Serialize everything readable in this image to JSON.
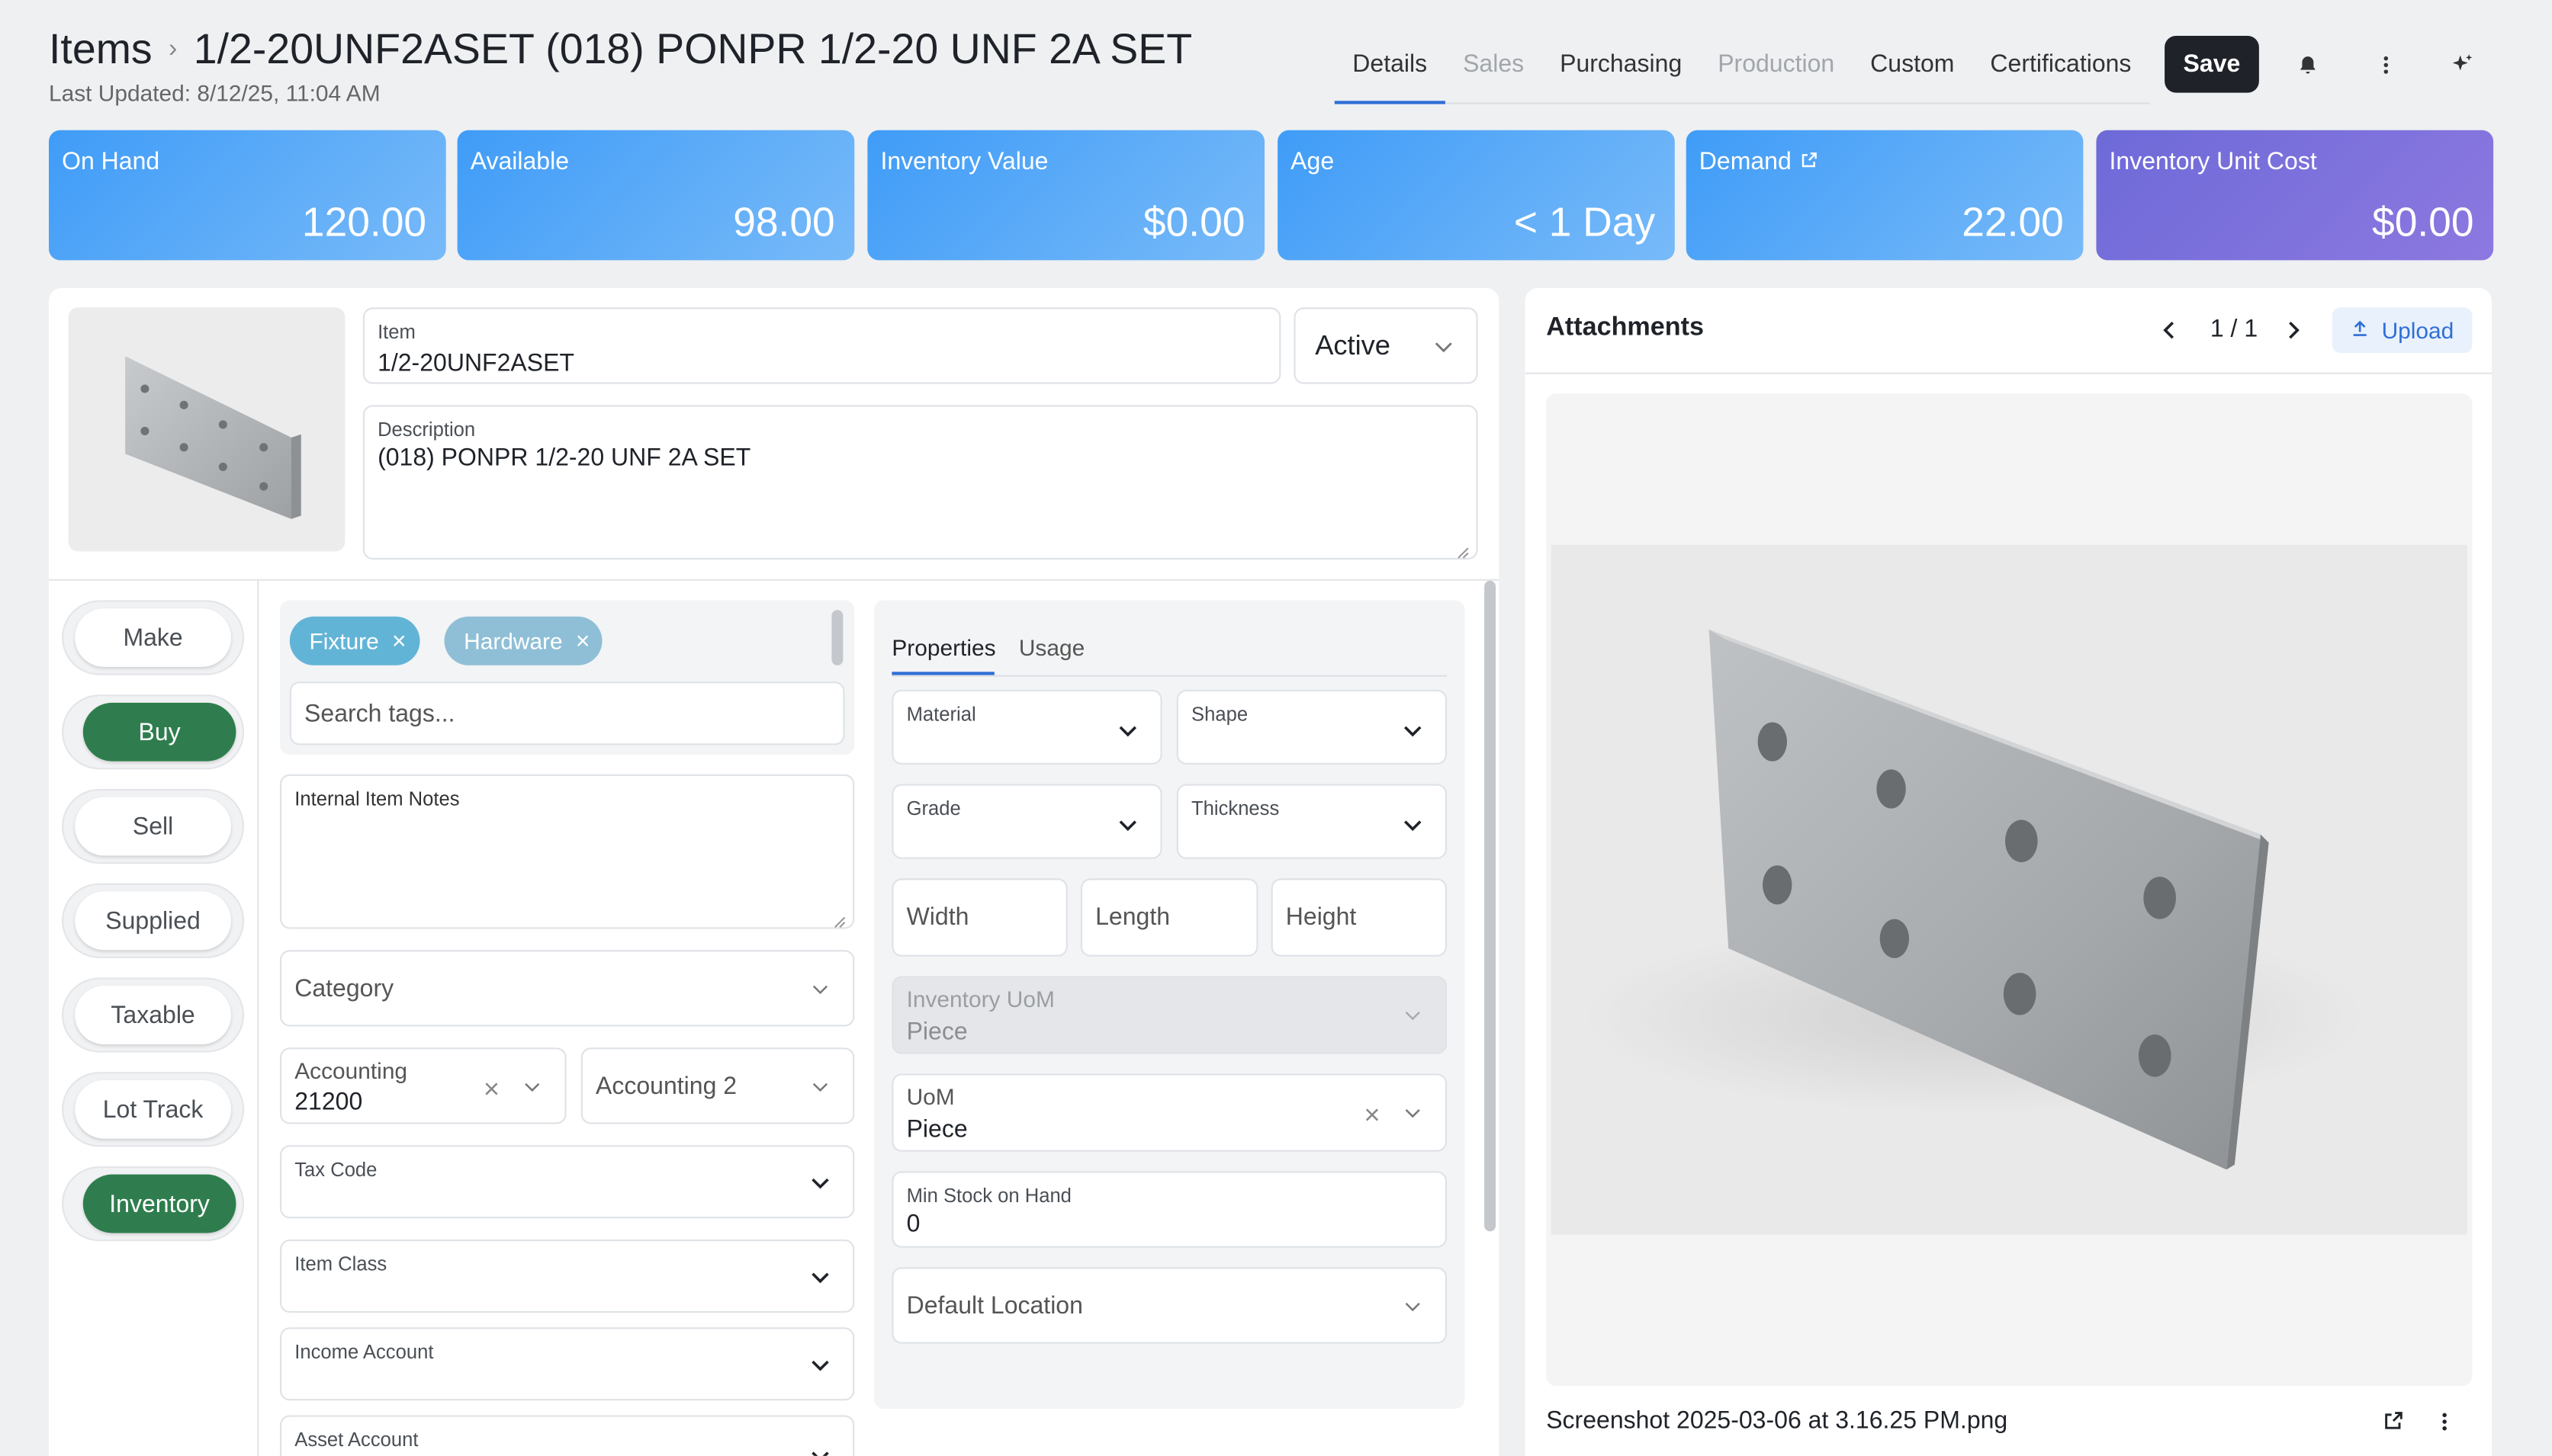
{
  "header": {
    "breadcrumb_root": "Items",
    "title": "1/2-20UNF2ASET (018) PONPR 1/2-20 UNF 2A SET",
    "last_updated": "Last Updated: 8/12/25, 11:04 AM",
    "tabs": [
      {
        "label": "Details",
        "state": "active"
      },
      {
        "label": "Sales",
        "state": "disabled"
      },
      {
        "label": "Purchasing",
        "state": "enabled"
      },
      {
        "label": "Production",
        "state": "disabled"
      },
      {
        "label": "Custom",
        "state": "enabled"
      },
      {
        "label": "Certifications",
        "state": "enabled"
      }
    ],
    "save_label": "Save",
    "icons": [
      "bell-icon",
      "more-vertical-icon",
      "sparkles-icon"
    ]
  },
  "stats": [
    {
      "label": "On Hand",
      "value": "120.00"
    },
    {
      "label": "Available",
      "value": "98.00"
    },
    {
      "label": "Inventory Value",
      "value": "$0.00"
    },
    {
      "label": "Age",
      "value": "< 1 Day"
    },
    {
      "label": "Demand",
      "value": "22.00",
      "icon": "external-link-icon"
    },
    {
      "label": "Inventory Unit Cost",
      "value": "$0.00"
    }
  ],
  "colors": {
    "accent": "#2f6fd6",
    "toggle_on": "#2f7d4e",
    "card_blue": "#5aaaf8",
    "card_purple": "#7b72dc",
    "tag_fixture": "#62b4d6",
    "tag_hardware": "#8fbfd6"
  },
  "item": {
    "item_label": "Item",
    "item_value": "1/2-20UNF2ASET",
    "status": "Active",
    "description_label": "Description",
    "description_value": "(018) PONPR 1/2-20 UNF 2A SET"
  },
  "toggles": [
    {
      "label": "Make",
      "on": false
    },
    {
      "label": "Buy",
      "on": true
    },
    {
      "label": "Sell",
      "on": false
    },
    {
      "label": "Supplied",
      "on": false
    },
    {
      "label": "Taxable",
      "on": false
    },
    {
      "label": "Lot Track",
      "on": false
    },
    {
      "label": "Inventory",
      "on": true
    }
  ],
  "tags": {
    "items": [
      {
        "label": "Fixture"
      },
      {
        "label": "Hardware"
      }
    ],
    "search_placeholder": "Search tags..."
  },
  "left_form": {
    "notes_label": "Internal Item Notes",
    "category_placeholder": "Category",
    "accounting_label": "Accounting",
    "accounting_value": "21200",
    "accounting2_placeholder": "Accounting 2",
    "tax_code_label": "Tax Code",
    "item_class_label": "Item Class",
    "income_account_label": "Income Account",
    "asset_account_label": "Asset Account"
  },
  "properties": {
    "tabs": [
      "Properties",
      "Usage"
    ],
    "material_label": "Material",
    "shape_label": "Shape",
    "grade_label": "Grade",
    "thickness_label": "Thickness",
    "width_placeholder": "Width",
    "length_placeholder": "Length",
    "height_placeholder": "Height",
    "inventory_uom_label": "Inventory UoM",
    "inventory_uom_value": "Piece",
    "uom_label": "UoM",
    "uom_value": "Piece",
    "min_stock_label": "Min Stock on Hand",
    "min_stock_value": "0",
    "default_location_placeholder": "Default Location"
  },
  "attachments": {
    "title": "Attachments",
    "page_indicator": "1 / 1",
    "upload_label": "Upload",
    "file_name": "Screenshot 2025-03-06 at 3.16.25 PM.png"
  }
}
